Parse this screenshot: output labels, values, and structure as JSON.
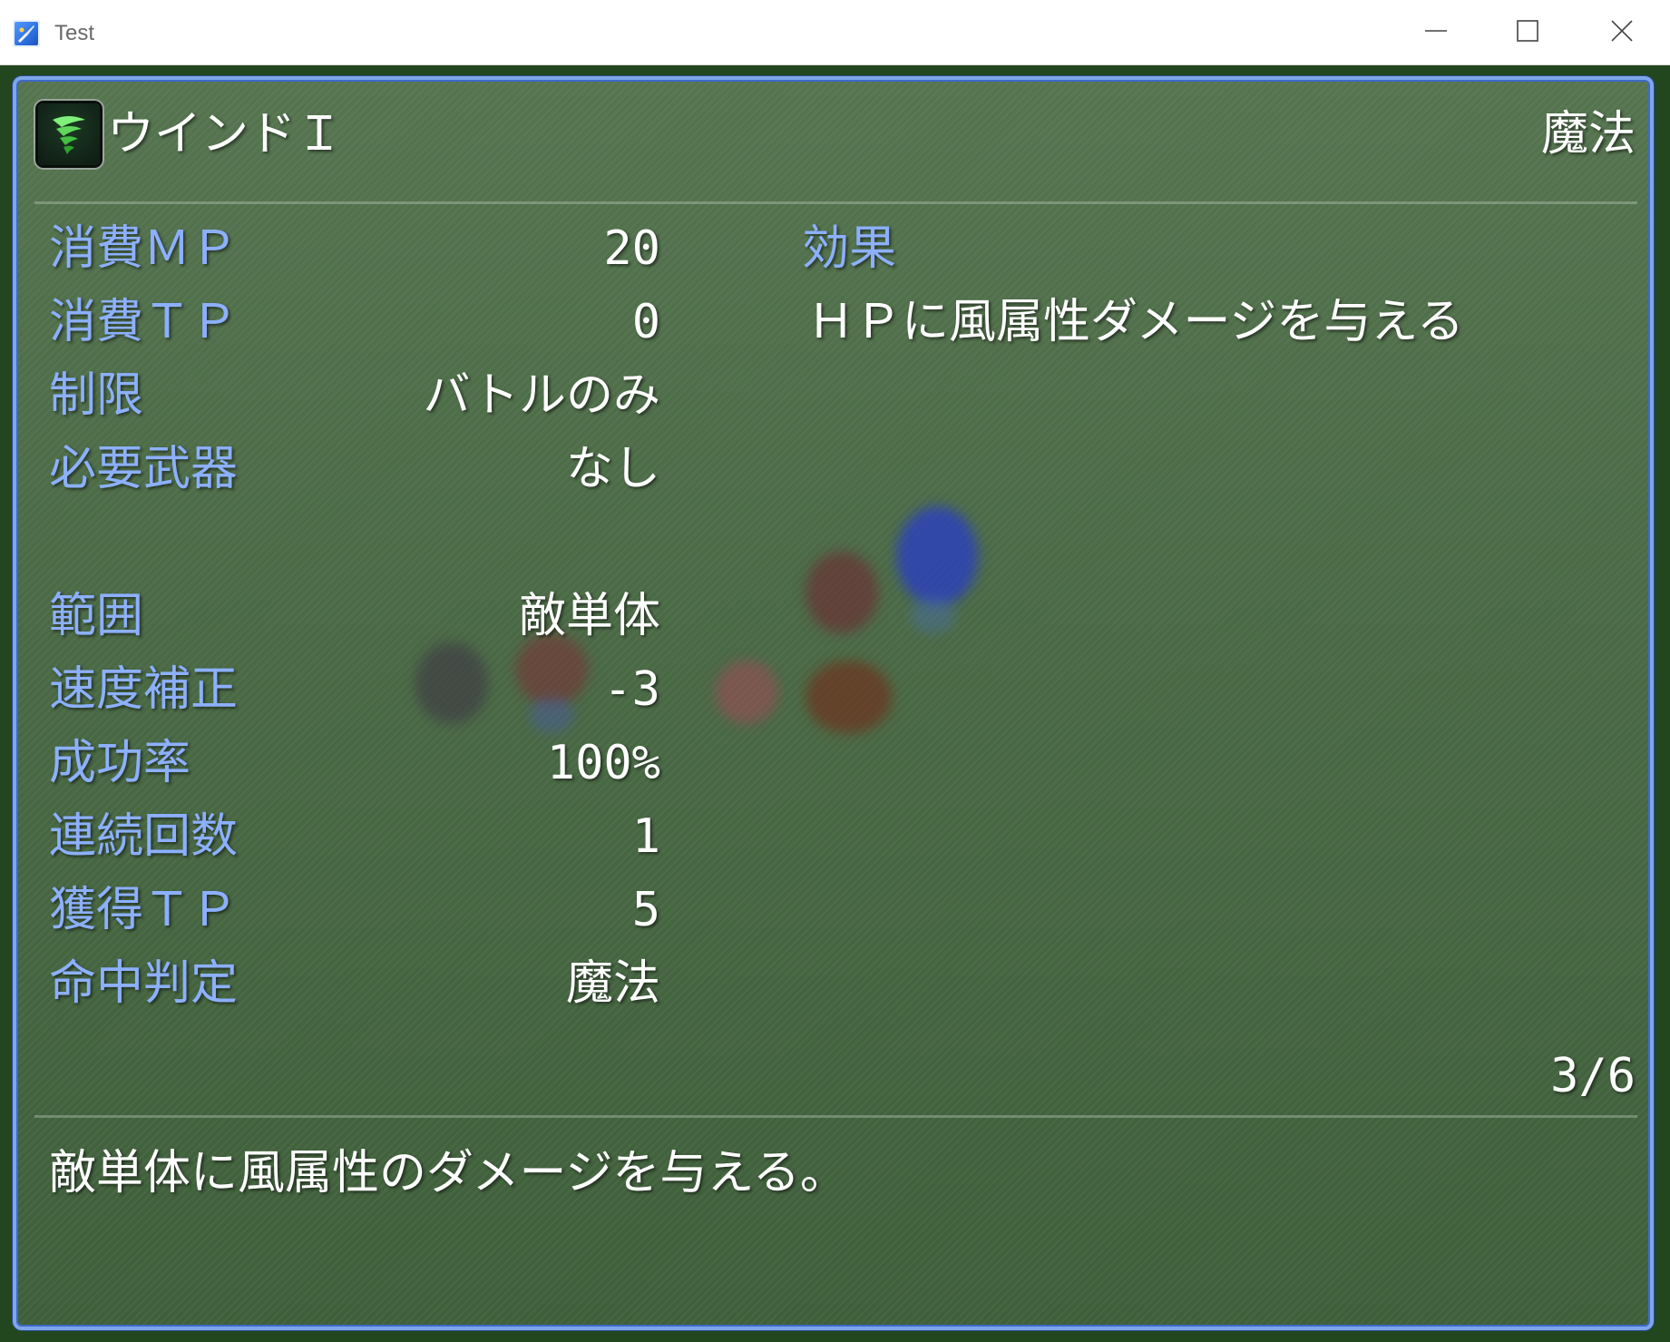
{
  "window": {
    "title": "Test"
  },
  "skill": {
    "name": "ウインドＩ",
    "type": "魔法",
    "icon": "whirlwind-icon"
  },
  "stats": [
    {
      "label": "消費ＭＰ",
      "value": "20"
    },
    {
      "label": "消費ＴＰ",
      "value": "0"
    },
    {
      "label": "制限",
      "value": "バトルのみ"
    },
    {
      "label": "必要武器",
      "value": "なし"
    },
    {
      "label": "範囲",
      "value": "敵単体"
    },
    {
      "label": "速度補正",
      "value": "-3"
    },
    {
      "label": "成功率",
      "value": "100%"
    },
    {
      "label": "連続回数",
      "value": "1"
    },
    {
      "label": "獲得ＴＰ",
      "value": "5"
    },
    {
      "label": "命中判定",
      "value": "魔法"
    }
  ],
  "effects": {
    "heading": "効果",
    "items": [
      "ＨＰに風属性ダメージを与える"
    ]
  },
  "page_indicator": "3/6",
  "description": "敵単体に風属性のダメージを与える。",
  "colors": {
    "label": "#8cb0ff",
    "value": "#ffffff",
    "panel_border": "#7ea6ea",
    "panel_bg": "#4a6a45"
  }
}
